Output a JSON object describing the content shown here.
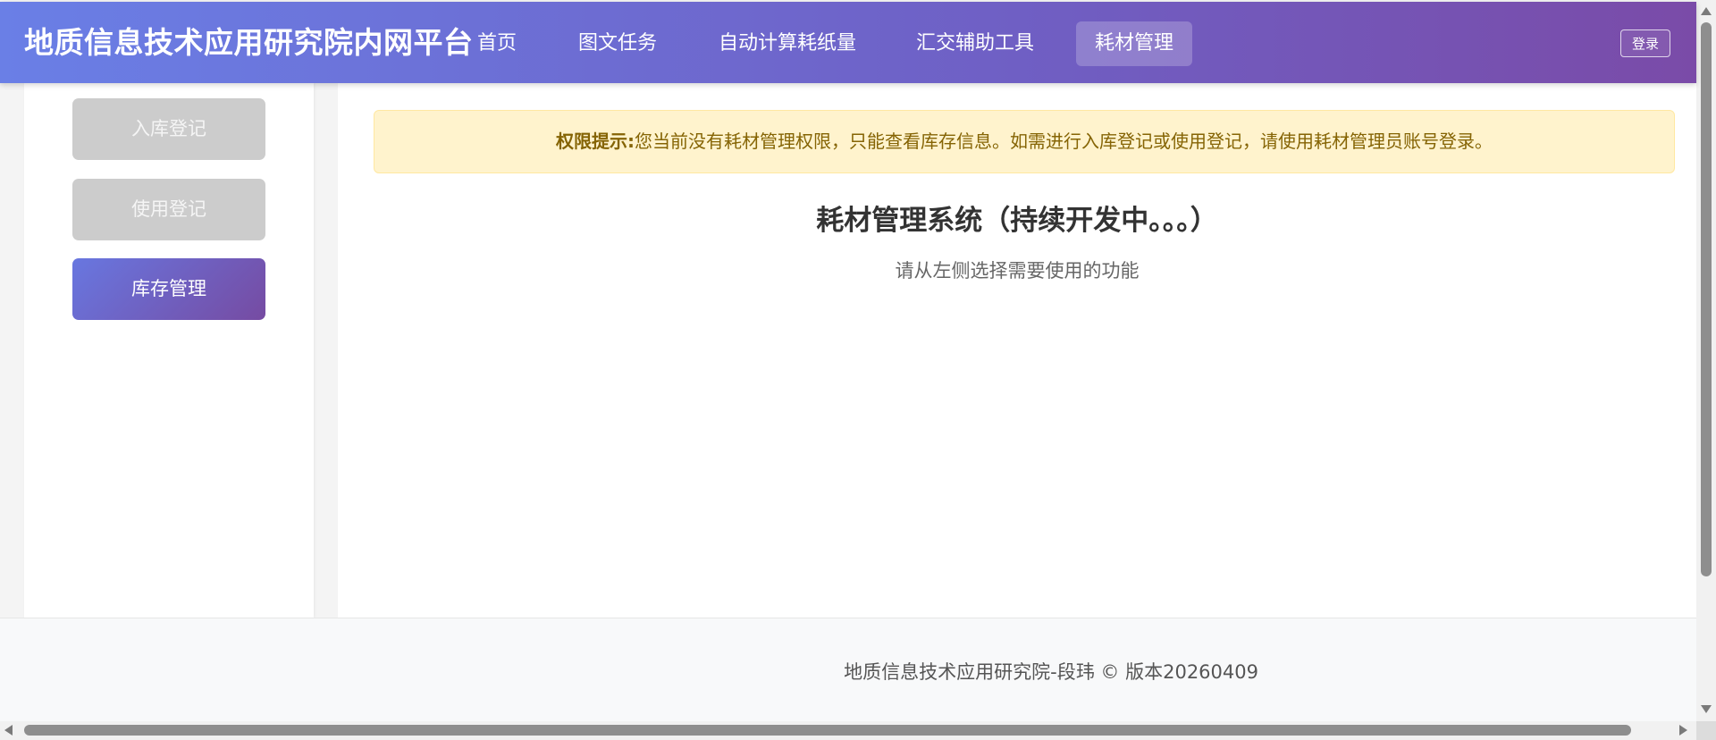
{
  "header": {
    "title": "地质信息技术应用研究院内网平台",
    "nav": [
      {
        "label": "首页"
      },
      {
        "label": "图文任务"
      },
      {
        "label": "自动计算耗纸量"
      },
      {
        "label": "汇交辅助工具"
      },
      {
        "label": "耗材管理"
      }
    ],
    "login_label": "登录"
  },
  "sidebar": {
    "items": [
      {
        "label": "入库登记",
        "state": "disabled"
      },
      {
        "label": "使用登记",
        "state": "disabled"
      },
      {
        "label": "库存管理",
        "state": "active"
      }
    ]
  },
  "main": {
    "alert_title": "权限提示:",
    "alert_text": "您当前没有耗材管理权限，只能查看库存信息。如需进行入库登记或使用登记，请使用耗材管理员账号登录。",
    "title": "耗材管理系统（持续开发中。。。）",
    "subtitle": "请从左侧选择需要使用的功能"
  },
  "footer": {
    "text": "地质信息技术应用研究院-段玮 © 版本20260409"
  },
  "colors": {
    "header_gradient_start": "#6a7fe6",
    "header_gradient_end": "#7a4ba8",
    "alert_bg": "#fff3cd",
    "alert_text": "#856404",
    "disabled_button": "#cccccc"
  }
}
